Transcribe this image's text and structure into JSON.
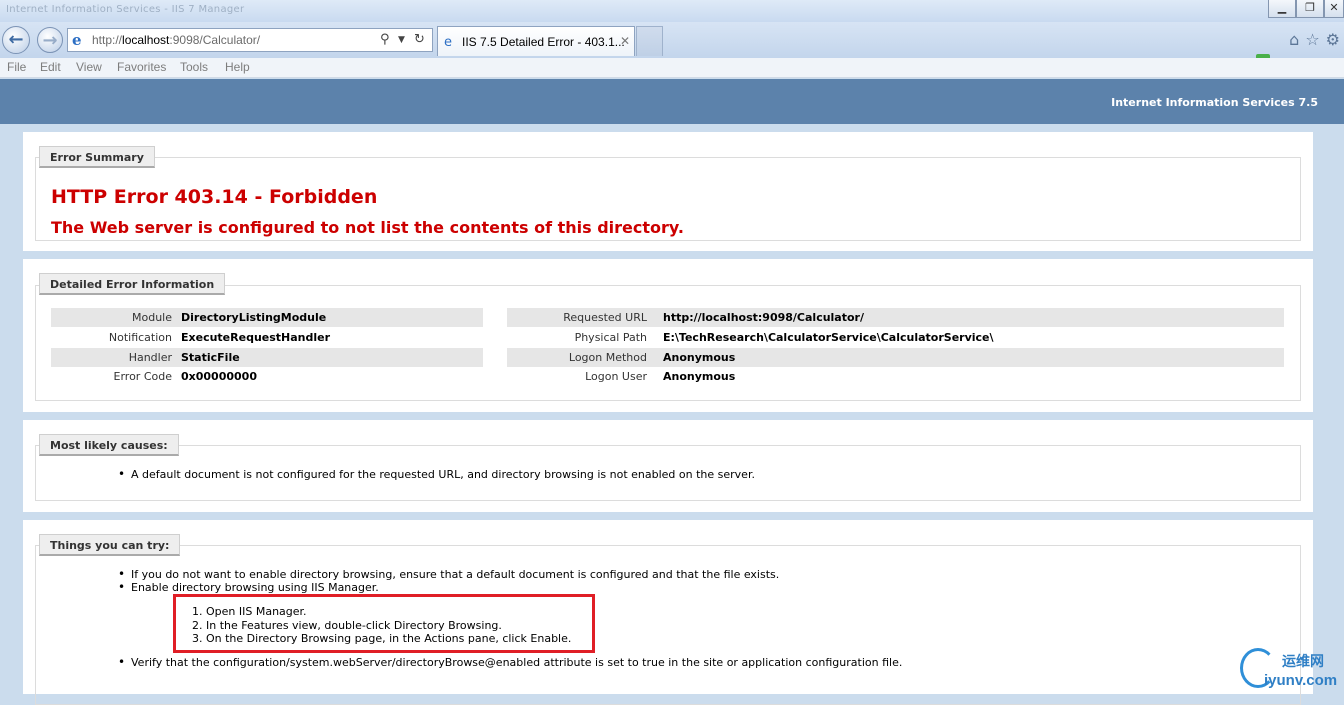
{
  "browser": {
    "window_title": "Internet Information Services - IIS 7 Manager",
    "url_prefix": "http://",
    "url_host": "localhost",
    "url_rest": ":9098/Calculator/",
    "tab_title": "IIS 7.5 Detailed Error - 403.1...",
    "menu": [
      "File",
      "Edit",
      "View",
      "Favorites",
      "Tools",
      "Help"
    ]
  },
  "header": {
    "product": "Internet Information Services 7.5"
  },
  "error_summary": {
    "legend": "Error Summary",
    "title": "HTTP Error 403.14 - Forbidden",
    "subtitle": "The Web server is configured to not list the contents of this directory."
  },
  "detailed_info": {
    "legend": "Detailed Error Information",
    "left": [
      {
        "key": "Module",
        "value": "DirectoryListingModule"
      },
      {
        "key": "Notification",
        "value": "ExecuteRequestHandler"
      },
      {
        "key": "Handler",
        "value": "StaticFile"
      },
      {
        "key": "Error Code",
        "value": "0x00000000"
      }
    ],
    "right": [
      {
        "key": "Requested URL",
        "value": "http://localhost:9098/Calculator/"
      },
      {
        "key": "Physical Path",
        "value": "E:\\TechResearch\\CalculatorService\\CalculatorService\\"
      },
      {
        "key": "Logon Method",
        "value": "Anonymous"
      },
      {
        "key": "Logon User",
        "value": "Anonymous"
      }
    ]
  },
  "causes": {
    "legend": "Most likely causes:",
    "items": [
      "A default document is not configured for the requested URL, and directory browsing is not enabled on the server."
    ]
  },
  "try": {
    "legend": "Things you can try:",
    "bullet1": "If you do not want to enable directory browsing, ensure that a default document is configured and that the file exists.",
    "bullet2": "Enable directory browsing using IIS Manager.",
    "steps": [
      "1.  Open IIS Manager.",
      "2.  In the Features view, double-click Directory Browsing.",
      "3.  On the Directory Browsing page, in the Actions pane, click Enable."
    ],
    "bullet3": "Verify that the configuration/system.webServer/directoryBrowse@enabled attribute is set to true in the site or application configuration file."
  },
  "watermark": {
    "cn": "运维网",
    "en": "iyunv.com"
  },
  "colors": {
    "header": "#5c82ab",
    "error_red": "#cc0000",
    "annotation_red": "#e01e26"
  }
}
